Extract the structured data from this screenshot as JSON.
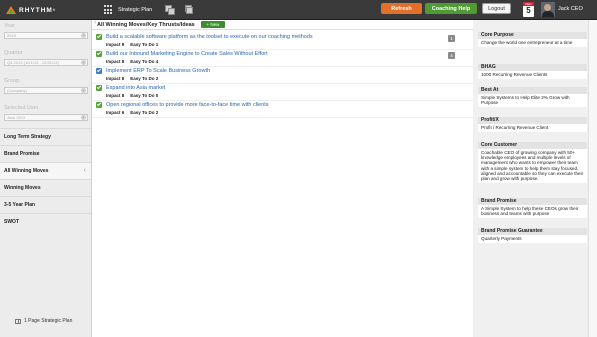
{
  "topbar": {
    "logo": "RHYTHM",
    "logo_mark": "®",
    "strategic_plan": "Strategic Plan",
    "refresh": "Refresh",
    "coaching_help": "Coaching Help",
    "logout": "Logout",
    "calendar_month": "DEC",
    "calendar_day": "5",
    "user_name": "Jack CEO"
  },
  "sidebar": {
    "filters": [
      {
        "label": "Year",
        "value": "2013"
      },
      {
        "label": "Quarter",
        "value": "Q4-2013 (10/1/13 - 12/31/13)"
      },
      {
        "label": "Group",
        "value": "(Company)"
      },
      {
        "label": "Selected User",
        "value": "Jack CEO"
      }
    ],
    "nav": [
      "Long Term Strategy",
      "Brand Promise",
      "All Winning Moves",
      "Winning Moves",
      "3-5 Year Plan",
      "SWOT"
    ],
    "bottom_link": "1 Page Strategic Plan"
  },
  "main": {
    "title": "All Winning Moves/Key Thrusts/Ideas",
    "new_button": "+ New",
    "rows": [
      {
        "title": "Build a scalable software platform as the toolset to execute on our coaching methods",
        "impact": "Impact 9",
        "ease": "Easy To Do 1",
        "badge": "1"
      },
      {
        "title": "Build our Inbound Marketing Engine to Create Sales Without Effort",
        "impact": "Impact 8",
        "ease": "Easy To Do 4",
        "badge": "4"
      },
      {
        "title": "Implement ERP To Scale Business Growth",
        "impact": "Impact 8",
        "ease": "Easy To Do 2",
        "badge": ""
      },
      {
        "title": "Expand into Asia market",
        "impact": "Impact 8",
        "ease": "Easy To Do 0",
        "badge": ""
      },
      {
        "title": "Open regional offices to provide more face-to-face time with clients",
        "impact": "Impact 6",
        "ease": "Easy To Do 2",
        "badge": ""
      }
    ]
  },
  "right": {
    "cards": [
      {
        "header": "Core Purpose",
        "body": "Change the world one entrepreneur at a time"
      },
      {
        "header": "BHAG",
        "body": "1000 Recurring Revenue Clients"
      },
      {
        "header": "Best At",
        "body": "Simple Systems to Help Elite 2% Grow with Purpose"
      },
      {
        "header": "Profit/X",
        "body": "Profit / Recurring Revenue Client"
      },
      {
        "header": "Core Customer",
        "body": "Coachable CEO of growing company with 50+ knowledge employees and multiple levels of management who wants to empower their team with a simple system to help them stay focused, aligned and accountable so they can execute their plan and grow with purpose."
      },
      {
        "header": "Brand Promise",
        "body": "A Simple System to help these CEOs grow their business and teams with purpose"
      },
      {
        "header": "Brand Promise Guarantee",
        "body": "Quarterly Payments"
      }
    ]
  }
}
